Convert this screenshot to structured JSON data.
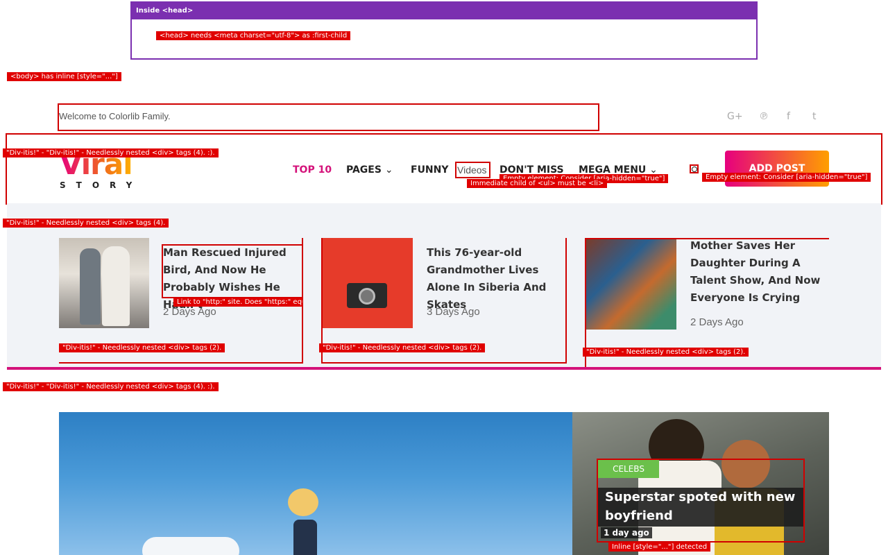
{
  "head_panel": {
    "title": "Inside <head>",
    "issue": "<head> needs <meta charset=\"utf-8\"> as :first-child"
  },
  "body_issue": "<body> has inline [style=\"...\"]",
  "topbar": {
    "welcome": "Welcome to Colorlib Family.",
    "social_icons": [
      "google-plus-icon",
      "pinterest-icon",
      "facebook-icon",
      "twitter-icon"
    ],
    "social_glyphs": [
      "G+",
      "℗",
      "f",
      "t"
    ]
  },
  "logo": {
    "main": "Viral",
    "sub": "STORY"
  },
  "nav": {
    "items": [
      "TOP 10",
      "PAGES",
      "FUNNY",
      "Videos",
      "DON'T MISS",
      "MEGA MENU"
    ],
    "add_post": "ADD POST"
  },
  "issues": {
    "divitis_double": "\"Div-itis!\" - \"Div-itis!\" - Needlessly nested <div> tags (4). :).",
    "divitis_4": "\"Div-itis!\" - Needlessly nested <div> tags (4).",
    "divitis_2": "\"Div-itis!\" - Needlessly nested <div> tags (2).",
    "inline_style": "Inline [style=\"...\"] detected",
    "empty_element": "Empty element: Consider [aria-hidden=\"true\"]",
    "immediate_child": "Immediate child of <ul> must be <li>",
    "link_http": "Link to \"http:\" site. Does \"https:\" equivalent exist?"
  },
  "trending": [
    {
      "title": "Man Rescued Injured Bird, And Now He Probably Wishes He Hadn’t",
      "date": "2 Days Ago"
    },
    {
      "title": "This 76-year-old Grandmother Lives Alone In Siberia And Skates",
      "date": "3 Days Ago"
    },
    {
      "title": "Mother Saves Her Daughter During A Talent Show, And Now Everyone Is Crying",
      "date": "2 Days Ago"
    }
  ],
  "featured": {
    "category": "CELEBS",
    "title": "Superstar spoted with new boyfriend",
    "date": "1 day ago"
  },
  "colors": {
    "brand_pink": "#d4127a",
    "issue_red": "#e00000",
    "head_purple": "#7b2fb0",
    "celebs_green": "#6bc04b"
  }
}
